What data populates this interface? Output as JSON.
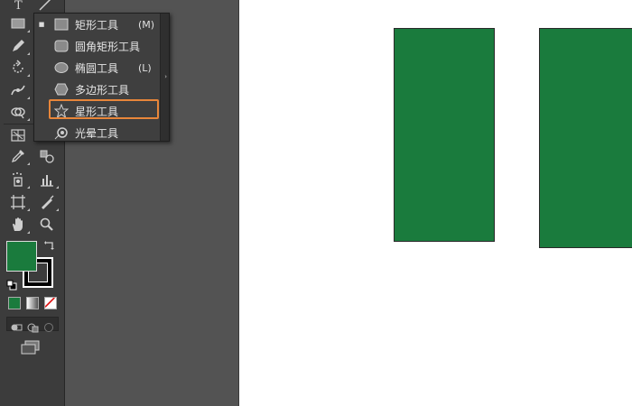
{
  "colors": {
    "fill": "#1a7b3d",
    "stroke": "#000000",
    "canvas": "#ffffff",
    "highlight": "#e8863a"
  },
  "toolbar": {
    "tools": [
      "type-tool",
      "line-tool",
      "rectangle-tool",
      "paintbrush-tool",
      "pencil-tool",
      "rotate-tool",
      "width-tool",
      "shape-builder-tool",
      "graph-tool",
      "eyedropper-tool",
      "blend-tool",
      "symbol-sprayer-tool",
      "column-graph-tool",
      "artboard-tool",
      "slice-tool",
      "hand-tool",
      "zoom-tool"
    ]
  },
  "flyout": {
    "items": [
      {
        "label": "矩形工具",
        "shortcut": "(M)",
        "icon": "rectangle-icon",
        "checked": true
      },
      {
        "label": "圆角矩形工具",
        "shortcut": "",
        "icon": "rounded-rectangle-icon",
        "checked": false
      },
      {
        "label": "椭圆工具",
        "shortcut": "(L)",
        "icon": "ellipse-icon",
        "checked": false
      },
      {
        "label": "多边形工具",
        "shortcut": "",
        "icon": "polygon-icon",
        "checked": false
      },
      {
        "label": "星形工具",
        "shortcut": "",
        "icon": "star-icon",
        "checked": false,
        "highlighted": true
      },
      {
        "label": "光晕工具",
        "shortcut": "",
        "icon": "flare-icon",
        "checked": false
      }
    ],
    "checkmark": "■",
    "tearoff": "›"
  }
}
